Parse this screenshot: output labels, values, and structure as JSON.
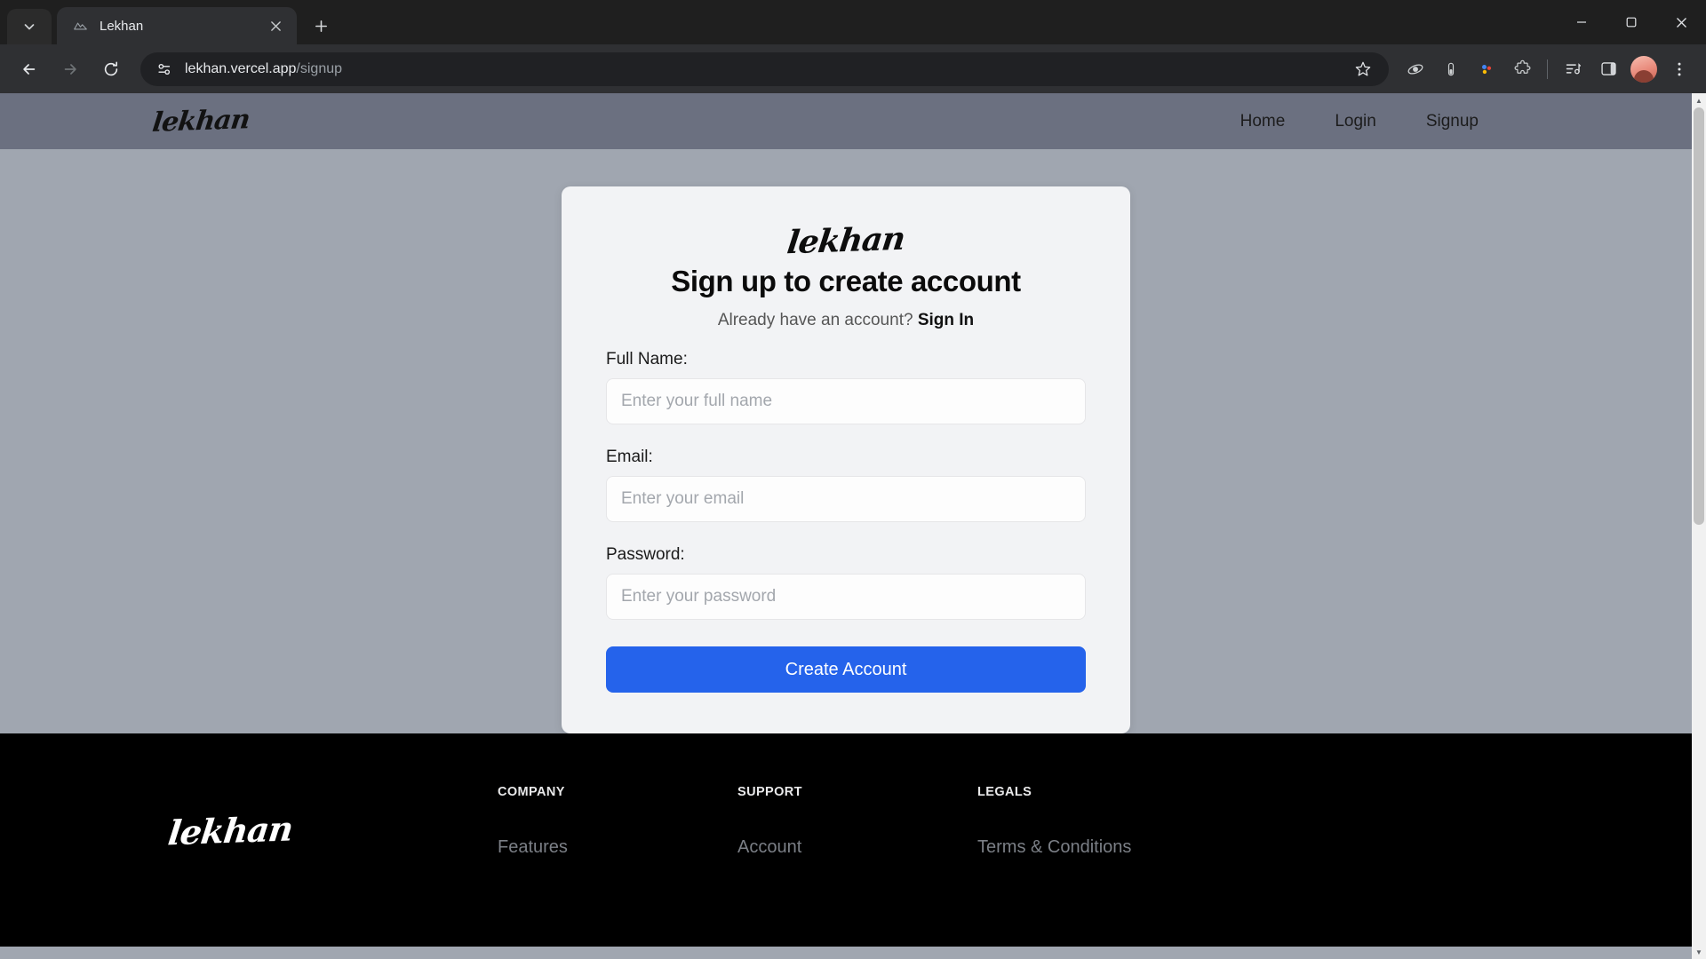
{
  "browser": {
    "tab": {
      "title": "Lekhan",
      "favicon_icon": "mountain-favicon",
      "close_icon": "close-icon"
    },
    "tab_list_icon": "chevron-down-icon",
    "new_tab_icon": "plus-icon",
    "new_tab_label": "+",
    "window_controls": {
      "minimize_icon": "minimize-icon",
      "maximize_icon": "maximize-icon",
      "close_icon": "close-icon"
    },
    "toolbar": {
      "back_icon": "back-arrow-icon",
      "forward_icon": "forward-arrow-icon",
      "reload_icon": "reload-icon",
      "site_info_icon": "site-settings-icon",
      "url_host": "lekhan.vercel.app",
      "url_path": "/signup",
      "bookmark_icon": "star-icon",
      "extensions": [
        "wave-extension-icon",
        "battery-extension-icon",
        "dots-extension-icon",
        "puzzle-extension-icon"
      ],
      "media_icon": "media-control-icon",
      "side_panel_icon": "side-panel-icon",
      "profile_icon": "profile-avatar",
      "menu_icon": "three-dot-menu-icon"
    }
  },
  "site": {
    "navbar": {
      "logo": "lekhan",
      "links": [
        {
          "label": "Home"
        },
        {
          "label": "Login"
        },
        {
          "label": "Signup"
        }
      ]
    },
    "signup_card": {
      "logo": "lekhan",
      "title": "Sign up to create account",
      "subtitle_text": "Already have an account? ",
      "subtitle_link": "Sign In",
      "fields": [
        {
          "label": "Full Name:",
          "placeholder": "Enter your full name",
          "value": ""
        },
        {
          "label": "Email:",
          "placeholder": "Enter your email",
          "value": ""
        },
        {
          "label": "Password:",
          "placeholder": "Enter your password",
          "value": ""
        }
      ],
      "submit_label": "Create Account",
      "accent_color": "#2563eb"
    },
    "footer": {
      "logo": "lekhan",
      "columns": [
        {
          "heading": "COMPANY",
          "links": [
            {
              "label": "Features"
            }
          ]
        },
        {
          "heading": "SUPPORT",
          "links": [
            {
              "label": "Account"
            }
          ]
        },
        {
          "heading": "LEGALS",
          "links": [
            {
              "label": "Terms & Conditions"
            }
          ]
        }
      ]
    }
  },
  "colors": {
    "page_bg": "#a0a6b0",
    "navbar_bg": "#6b7080",
    "card_bg": "#f2f3f5",
    "footer_bg": "#000000",
    "button": "#2563eb"
  }
}
